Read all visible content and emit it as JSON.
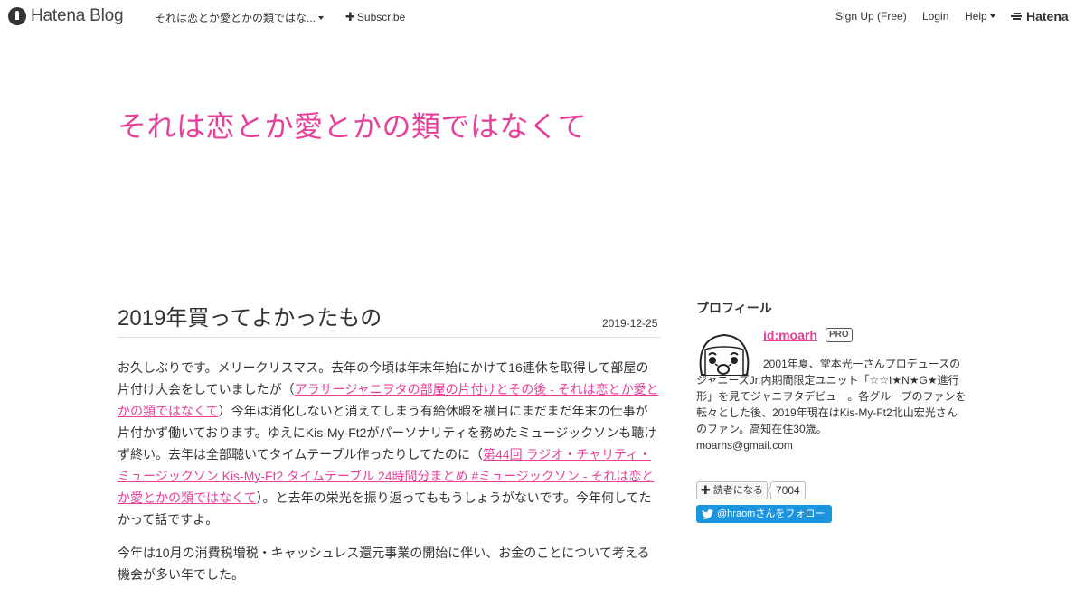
{
  "header": {
    "logo_text": "Hatena Blog",
    "blog_menu_label": "それは恋とか愛とかの類ではな...",
    "subscribe_label": "Subscribe",
    "signup_label": "Sign Up (Free)",
    "login_label": "Login",
    "help_label": "Help",
    "hatena_label": "Hatena"
  },
  "blog": {
    "title": "それは恋とか愛とかの類ではなくて",
    "accent_color": "#e8409a"
  },
  "entry": {
    "title": "2019年買ってよかったもの",
    "date": "2019-12-25",
    "p1_text1": "お久しぶりです。メリークリスマス。去年の今頃は年末年始にかけて16連休を取得して部屋の片付け大会をしていましたが（",
    "p1_link1": "アラサージャニヲタの部屋の片付けとその後 - それは恋とか愛とかの類ではなくて",
    "p1_text2": "）今年は消化しないと消えてしまう有給休暇を横目にまだまだ年末の仕事が片付かず働いております。ゆえにKis-My-Ft2がパーソナリティを務めたミュージックソンも聴けず終い。去年は全部聴いてタイムテーブル作ったりしてたのに（",
    "p1_link2": "第44回 ラジオ・チャリティ・ミュージックソン Kis-My-Ft2 タイムテーブル 24時間分まとめ #ミュージックソン - それは恋とか愛とかの類ではなくて",
    "p1_text3": "）。と去年の栄光を振り返ってももうしょうがないです。今年何してたかって話ですよ。",
    "p2_text": "今年は10月の消費税増税・キャッシュレス還元事業の開始に伴い、お金のことについて考える機会が多い年でした。"
  },
  "sidebar": {
    "heading": "プロフィール",
    "profile_id": "id:moarh",
    "pro_badge": "PRO",
    "description": "2001年夏、堂本光一さんプロデュースのジャニーズJr.内期間限定ユニット「☆☆I★N★G★進行形」を見てジャニヲタデビュー。各グループのファンを転々とした後、2019年現在はKis-My-Ft2北山宏光さんのファン。高知在住30歳。",
    "email": "moarhs@gmail.com",
    "subscribe_label": "読者になる",
    "subscriber_count": "7004",
    "twitter_label": "@hraomさんをフォロー"
  }
}
